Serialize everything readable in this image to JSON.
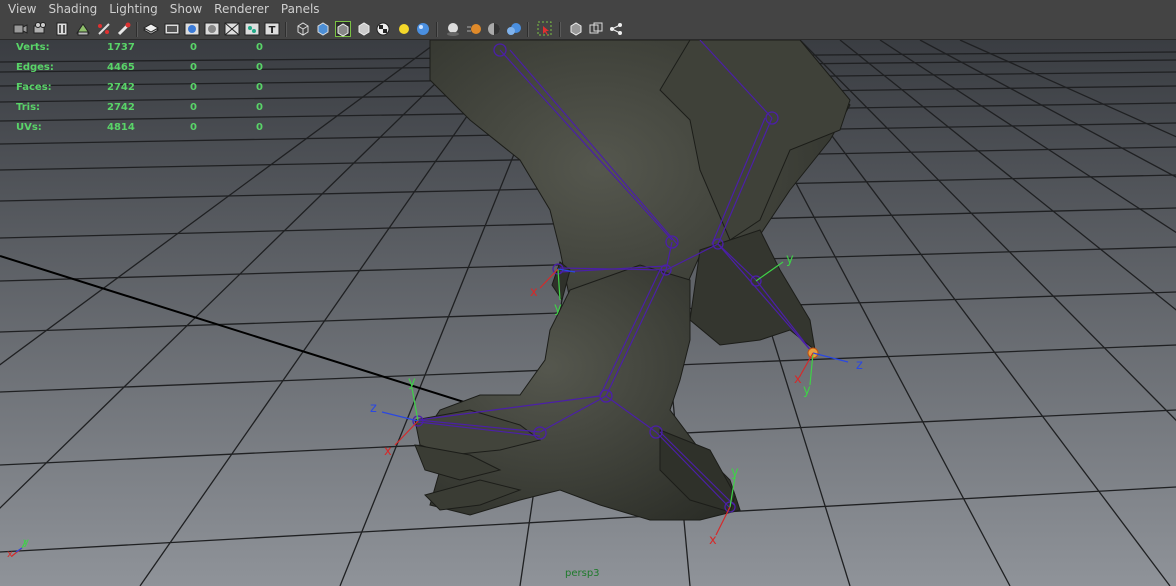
{
  "menubar": {
    "items": [
      "View",
      "Shading",
      "Lighting",
      "Show",
      "Renderer",
      "Panels"
    ]
  },
  "toolbar": {
    "icons": [
      "select-camera-icon",
      "camera-attributes-icon",
      "bookmarks-icon",
      "image-plane-icon",
      "grease-pencil-icon",
      "two-d-pan-zoom-icon",
      "grid-icon",
      "film-gate-icon",
      "resolution-gate-icon",
      "gate-mask-icon",
      "field-chart-icon",
      "safe-action-icon",
      "safe-title-icon",
      "wireframe-icon",
      "smooth-shade-icon",
      "wireframe-on-shaded-icon",
      "xray-icon",
      "textured-icon",
      "use-default-light-icon",
      "shadows-icon",
      "screen-space-ao-icon",
      "motion-blur-icon",
      "multisample-aa-icon",
      "depth-of-field-icon",
      "isolate-select-icon",
      "xray-joints-icon",
      "xray-active-icon",
      "wireframe-joints-icon"
    ]
  },
  "hud": {
    "rows": [
      {
        "label": "Verts:",
        "v1": "1737",
        "v2": "0",
        "v3": "0"
      },
      {
        "label": "Edges:",
        "v1": "4465",
        "v2": "0",
        "v3": "0"
      },
      {
        "label": "Faces:",
        "v1": "2742",
        "v2": "0",
        "v3": "0"
      },
      {
        "label": "Tris:",
        "v1": "2742",
        "v2": "0",
        "v3": "0"
      },
      {
        "label": "UVs:",
        "v1": "4814",
        "v2": "0",
        "v3": "0"
      }
    ]
  },
  "viewport": {
    "camera_name": "persp3",
    "axis_labels": {
      "x": "x",
      "y": "y",
      "z": "z"
    },
    "colors": {
      "background_top": "#3a3d42",
      "background_bottom": "#8f9399",
      "grid_line": "#1f2022",
      "axis_x": "#d52a2a",
      "axis_y": "#3fd148",
      "axis_z": "#2b48e0",
      "joint": "#5b2fbf",
      "mesh": "#3b3d35"
    }
  }
}
